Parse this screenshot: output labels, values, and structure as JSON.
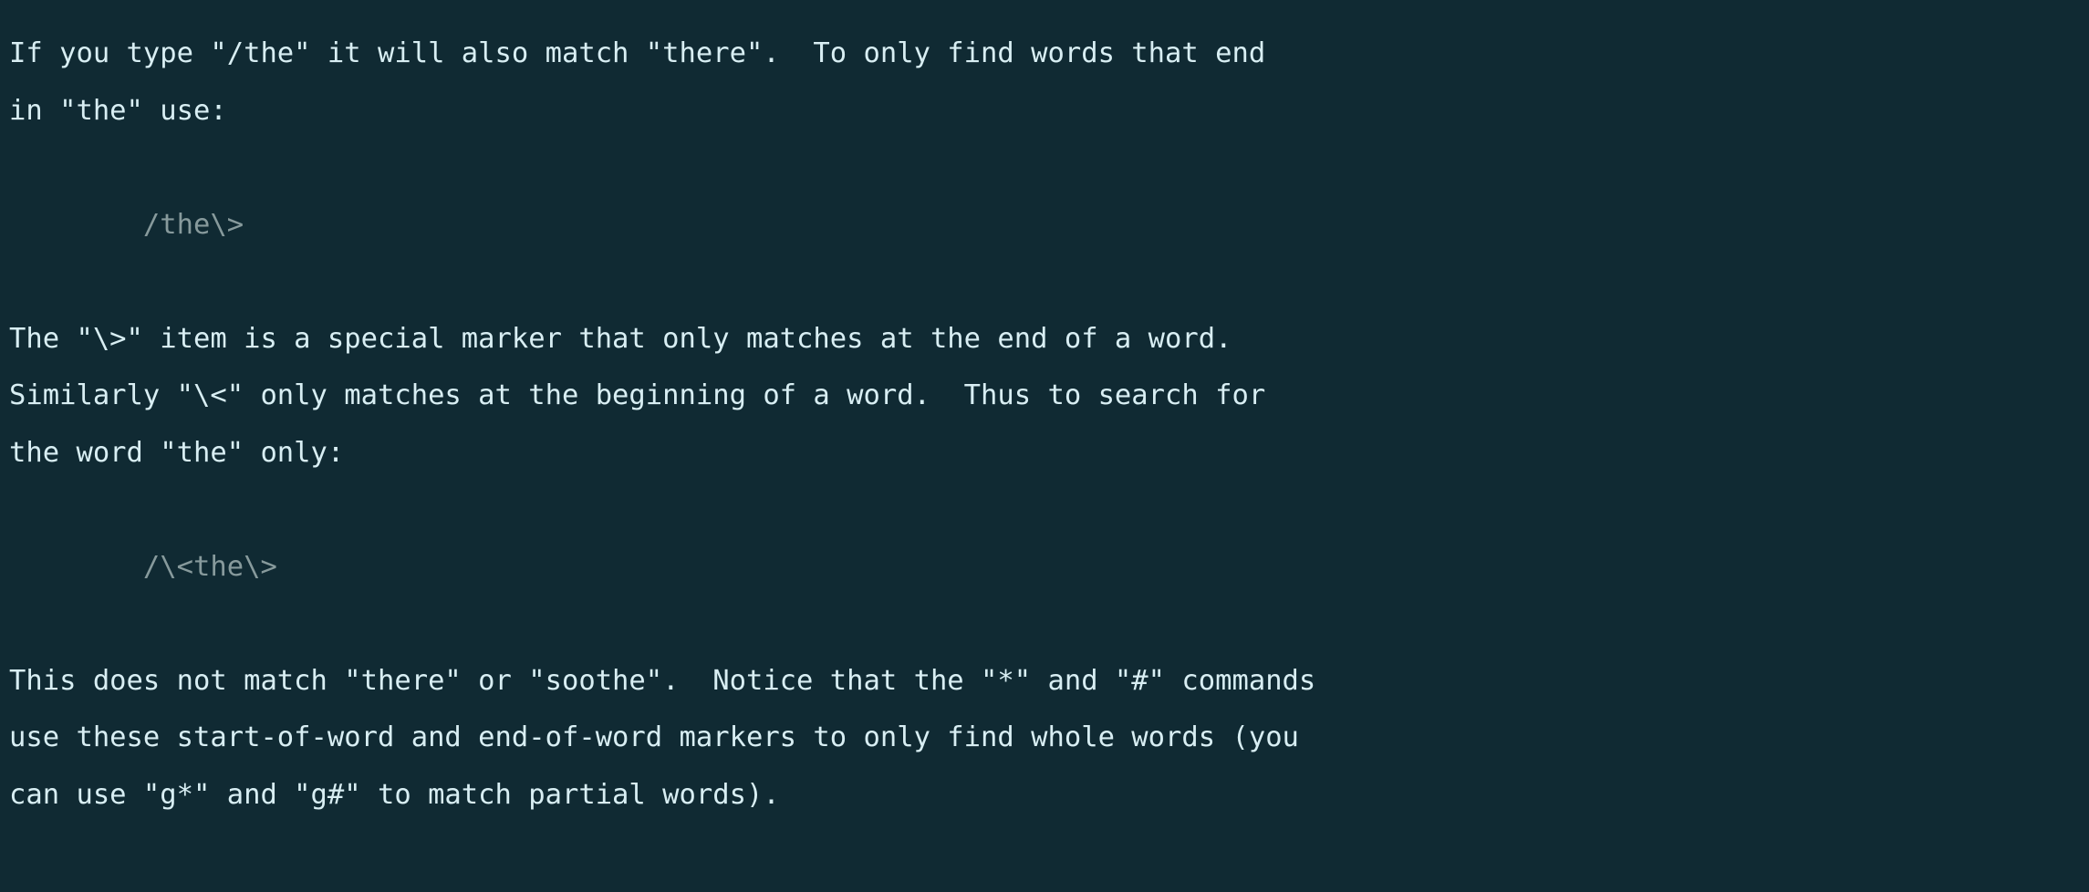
{
  "terminal": {
    "background_color": "#102a33",
    "text_color": "#d8eef3",
    "code_color": "#879a9c",
    "font_size_px": 30,
    "line_height_px": 62
  },
  "document": {
    "kind": "vim-help-text",
    "lines": [
      {
        "id": "line-1",
        "style": "body",
        "text": "If you type \"/the\" it will also match \"there\".  To only find words that end"
      },
      {
        "id": "line-2",
        "style": "body",
        "text": "in \"the\" use:"
      },
      {
        "id": "line-3",
        "style": "blank",
        "text": ""
      },
      {
        "id": "line-4",
        "style": "code",
        "text": "\t/the\\>"
      },
      {
        "id": "line-5",
        "style": "blank",
        "text": ""
      },
      {
        "id": "line-6",
        "style": "body",
        "text": "The \"\\>\" item is a special marker that only matches at the end of a word."
      },
      {
        "id": "line-7",
        "style": "body",
        "text": "Similarly \"\\<\" only matches at the beginning of a word.  Thus to search for"
      },
      {
        "id": "line-8",
        "style": "body",
        "text": "the word \"the\" only:"
      },
      {
        "id": "line-9",
        "style": "blank",
        "text": ""
      },
      {
        "id": "line-10",
        "style": "code",
        "text": "\t/\\<the\\>"
      },
      {
        "id": "line-11",
        "style": "blank",
        "text": ""
      },
      {
        "id": "line-12",
        "style": "body",
        "text": "This does not match \"there\" or \"soothe\".  Notice that the \"*\" and \"#\" commands"
      },
      {
        "id": "line-13",
        "style": "body",
        "text": "use these start-of-word and end-of-word markers to only find whole words (you"
      },
      {
        "id": "line-14",
        "style": "body",
        "text": "can use \"g*\" and \"g#\" to match partial words)."
      }
    ]
  }
}
